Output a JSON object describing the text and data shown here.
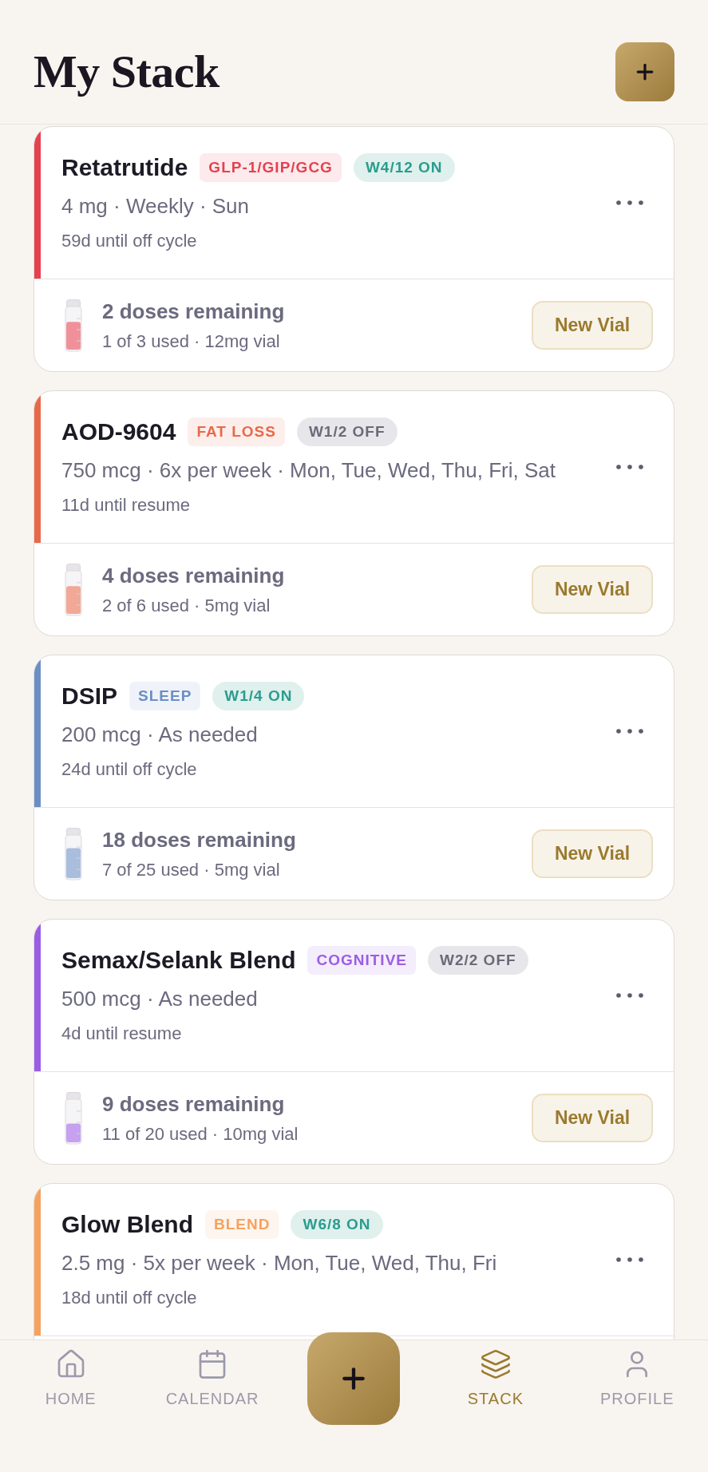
{
  "header": {
    "title": "My Stack"
  },
  "peptides": [
    {
      "name": "Retatrutide",
      "color": "#e5414f",
      "category": "GLP-1/GIP/GCG",
      "cycle": {
        "label": "W4/12 ON",
        "on": true
      },
      "dosage": "4 mg · Weekly · Sun",
      "status": "59d until off cycle",
      "vial": {
        "remaining": "2 doses remaining",
        "usage": "1 of 3 used · 12mg vial",
        "level": 0.67,
        "button": "New Vial"
      }
    },
    {
      "name": "AOD-9604",
      "color": "#e8694a",
      "category": "FAT LOSS",
      "cycle": {
        "label": "W1/2 OFF",
        "on": false
      },
      "dosage": "750 mcg · 6x per week · Mon, Tue, Wed, Thu, Fri, Sat",
      "status": "11d until resume",
      "vial": {
        "remaining": "4 doses remaining",
        "usage": "2 of 6 used · 5mg vial",
        "level": 0.67,
        "button": "New Vial"
      }
    },
    {
      "name": "DSIP",
      "color": "#6b8fc4",
      "category": "SLEEP",
      "cycle": {
        "label": "W1/4 ON",
        "on": true
      },
      "dosage": "200 mcg · As needed",
      "status": "24d until off cycle",
      "vial": {
        "remaining": "18 doses remaining",
        "usage": "7 of 25 used · 5mg vial",
        "level": 0.72,
        "button": "New Vial"
      }
    },
    {
      "name": "Semax/Selank Blend",
      "color": "#9b5de5",
      "category": "COGNITIVE",
      "cycle": {
        "label": "W2/2 OFF",
        "on": false
      },
      "dosage": "500 mcg · As needed",
      "status": "4d until resume",
      "vial": {
        "remaining": "9 doses remaining",
        "usage": "11 of 20 used · 10mg vial",
        "level": 0.45,
        "button": "New Vial"
      }
    },
    {
      "name": "Glow Blend",
      "color": "#f4a261",
      "category": "BLEND",
      "cycle": {
        "label": "W6/8 ON",
        "on": true
      },
      "dosage": "2.5 mg · 5x per week · Mon, Tue, Wed, Thu, Fri",
      "status": "18d until off cycle"
    }
  ],
  "nav": {
    "items": [
      {
        "kind": "home",
        "label": "HOME",
        "selected": false
      },
      {
        "kind": "calendar",
        "label": "CALENDAR",
        "selected": false
      },
      {
        "kind": "add"
      },
      {
        "kind": "stack",
        "label": "STACK",
        "selected": true
      },
      {
        "kind": "profile",
        "label": "PROFILE",
        "selected": false
      }
    ]
  }
}
